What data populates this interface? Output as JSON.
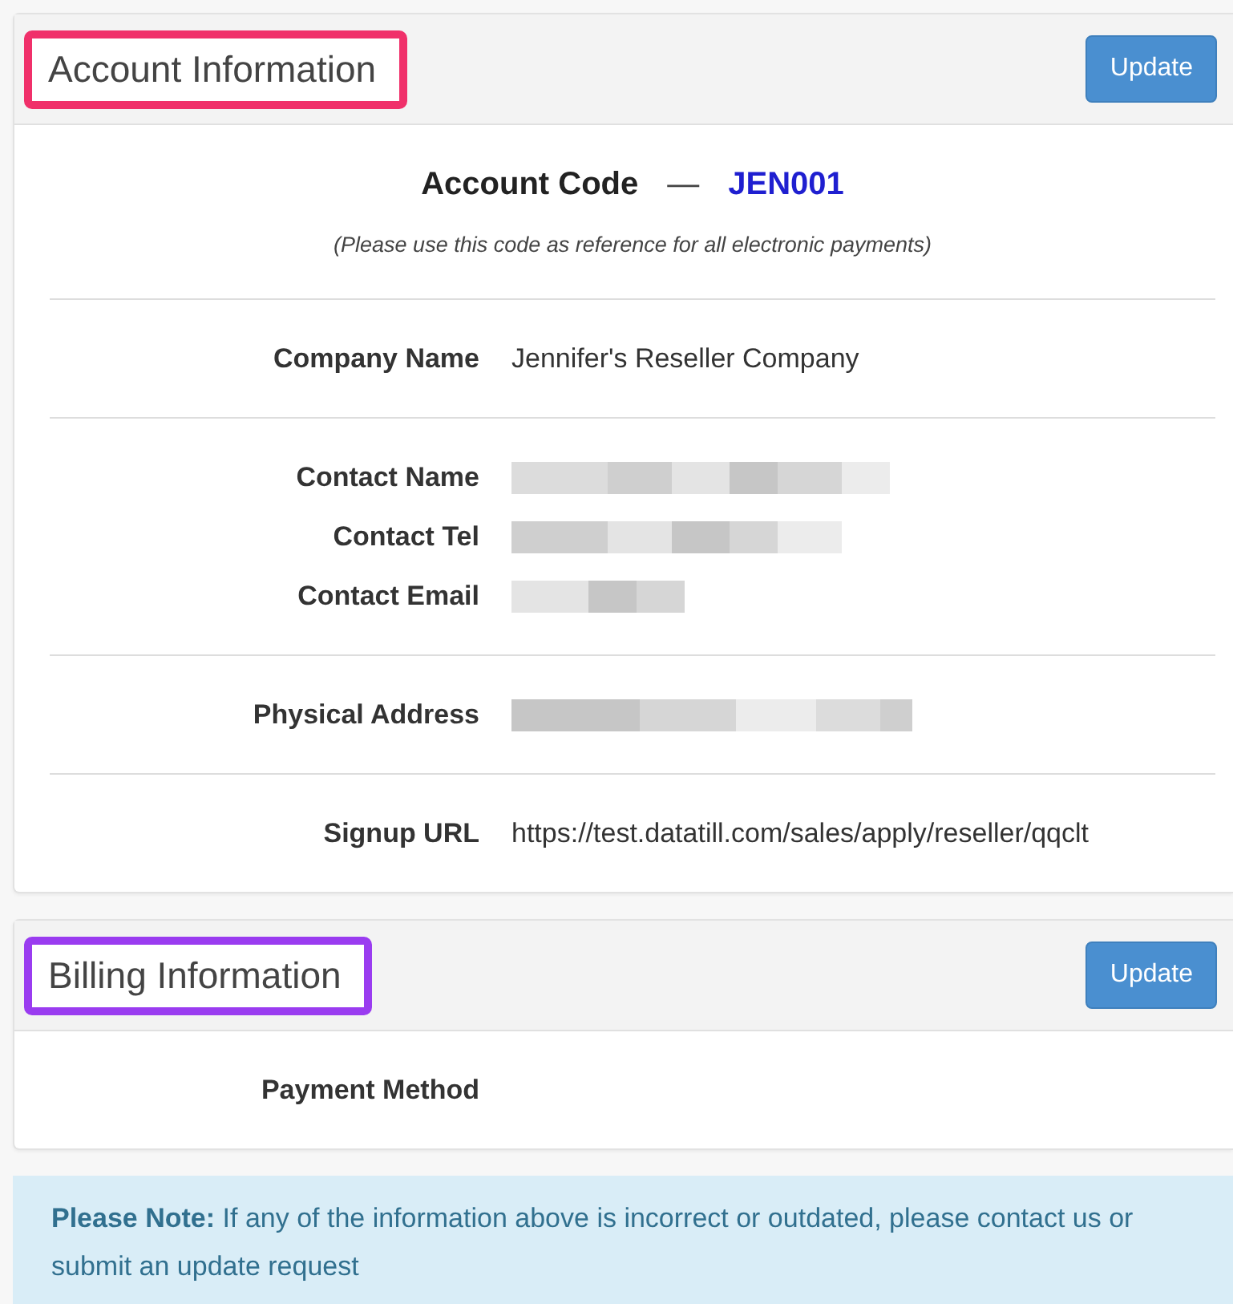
{
  "sections": [
    {
      "title": "Account Information",
      "color": "#f0306a",
      "button": "Update",
      "code_block": {
        "label": "Account Code",
        "dash": "—",
        "code": "JEN001",
        "note": "(Please use this code as reference for all electronic payments)"
      },
      "groups": [
        [
          {
            "label": "Company Name",
            "kind": "text",
            "value": "Jennifer's Reseller Company"
          }
        ],
        [
          {
            "label": "Contact Name",
            "kind": "redacted"
          },
          {
            "label": "Contact Tel",
            "kind": "redacted"
          },
          {
            "label": "Contact Email",
            "kind": "redacted"
          }
        ],
        [
          {
            "label": "Physical Address",
            "kind": "redacted"
          }
        ],
        [
          {
            "label": "Signup URL",
            "kind": "text",
            "value": "https://test.datatill.com/sales/apply/reseller/qqclt"
          }
        ]
      ]
    },
    {
      "title": "Billing Information",
      "color": "#9a3cf0",
      "button": "Update",
      "groups": [
        [
          {
            "label": "Payment Method",
            "kind": "empty"
          }
        ]
      ]
    }
  ],
  "notice": "**Please Note:**  If any of the information above is incorrect or outdated, please contact us or submit an update request"
}
